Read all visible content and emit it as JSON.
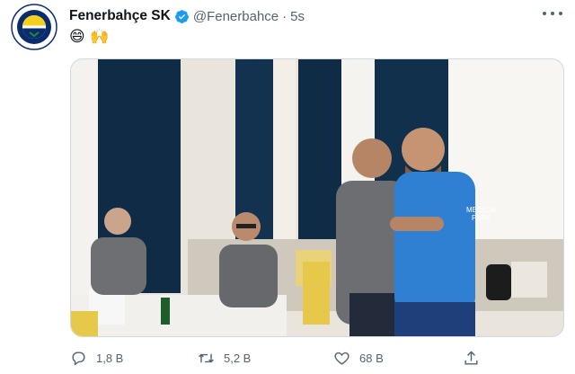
{
  "tweet": {
    "display_name": "Fenerbahçe SK",
    "handle": "@Fenerbahce",
    "separator": "·",
    "time": "5s",
    "text": "😄 🙌",
    "verified": true
  },
  "avatar": {
    "logo_text": "FENERBAHÇE SPOR KULÜBÜ",
    "logo_year": "1907",
    "colors": {
      "navy": "#0b2c6c",
      "yellow": "#f5d01e"
    }
  },
  "photo": {
    "jersey_text": "MEDICAL\nPARK",
    "colors": {
      "curtain": "#0f2b45",
      "shirt_grey": "#6d6f72",
      "shirt_blue": "#2f7fd2",
      "wall": "#e9e4dc"
    }
  },
  "actions": {
    "reply": {
      "icon": "reply-icon",
      "count": "1,8 B"
    },
    "retweet": {
      "icon": "retweet-icon",
      "count": "5,2 B"
    },
    "like": {
      "icon": "heart-icon",
      "count": "68 B"
    },
    "share": {
      "icon": "share-icon",
      "count": ""
    }
  },
  "colors": {
    "verified": "#1d9bf0",
    "muted": "#536471",
    "text": "#0f1419"
  }
}
